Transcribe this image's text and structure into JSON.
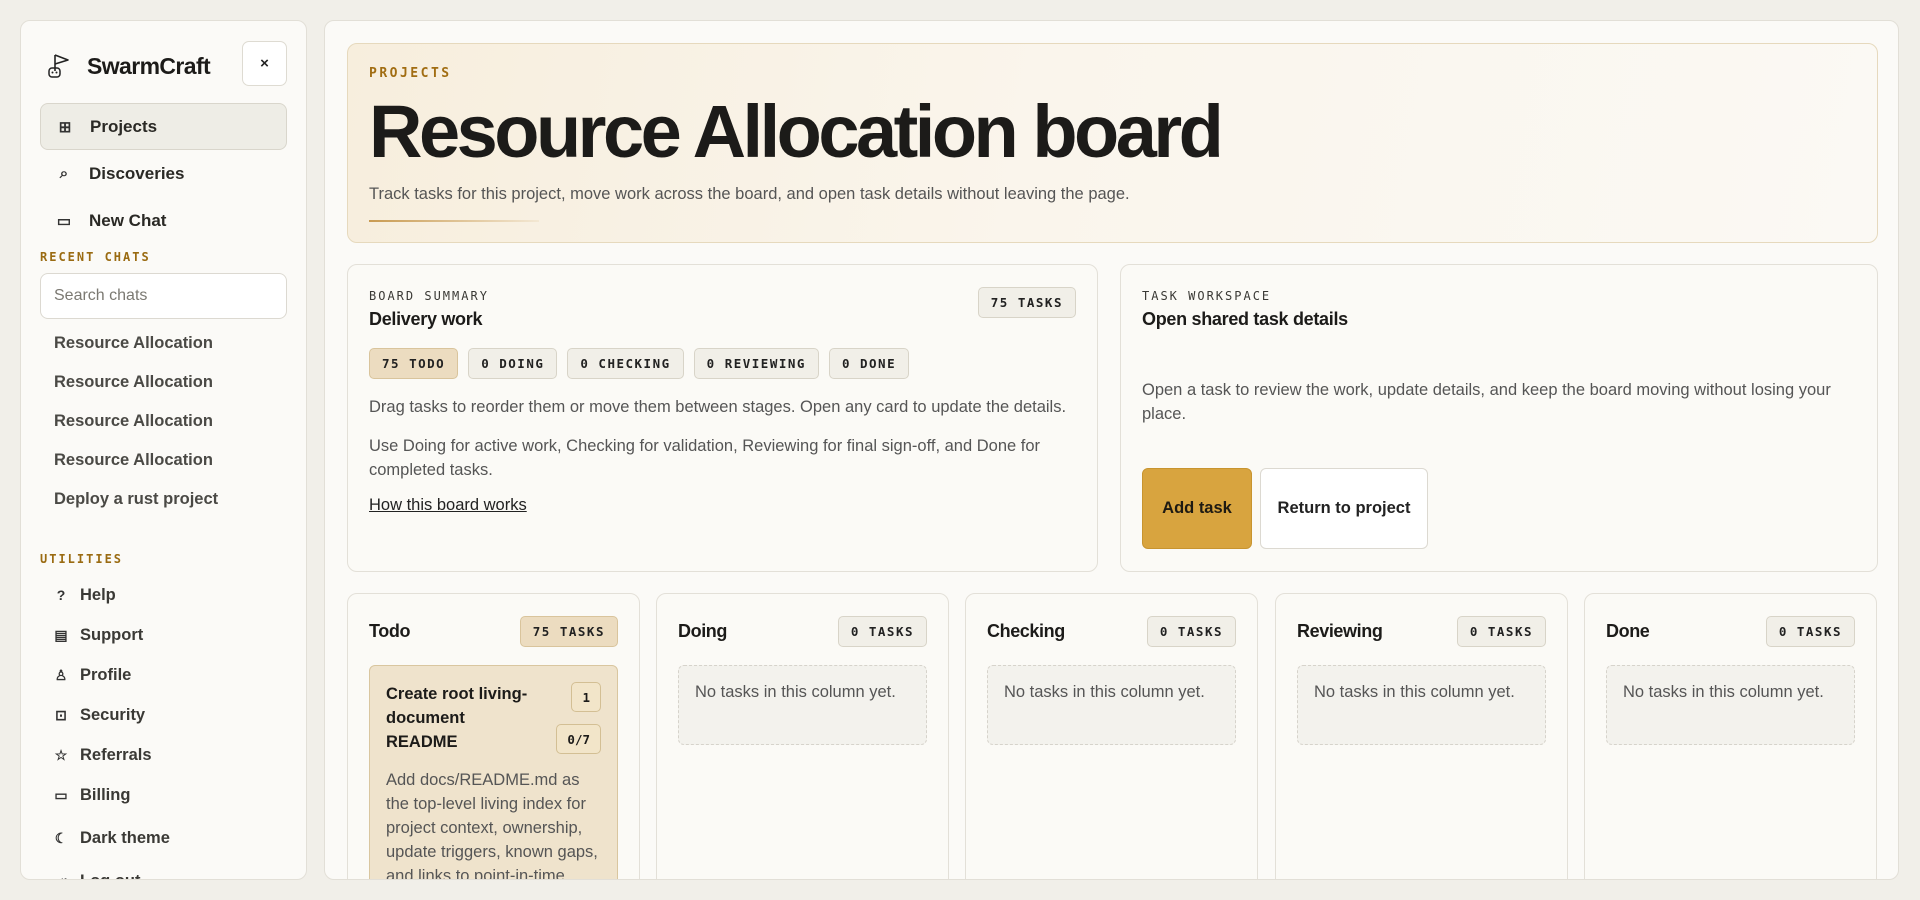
{
  "sidebar": {
    "brand": "SwarmCraft",
    "close_label": "×",
    "nav": [
      {
        "label": "Projects",
        "icon": "board-icon",
        "glyph": "⊞"
      },
      {
        "label": "Discoveries",
        "icon": "search-zoom-icon",
        "glyph": "⌕"
      },
      {
        "label": "New Chat",
        "icon": "chat-icon",
        "glyph": "▭"
      }
    ],
    "recent_label": "RECENT CHATS",
    "search_placeholder": "Search chats",
    "chats": [
      "Resource Allocation",
      "Resource Allocation",
      "Resource Allocation",
      "Resource Allocation",
      "Deploy a rust project"
    ],
    "utilities_label": "UTILITIES",
    "utilities": [
      {
        "label": "Help",
        "icon": "help-icon",
        "glyph": "?"
      },
      {
        "label": "Support",
        "icon": "support-icon",
        "glyph": "▤"
      },
      {
        "label": "Profile",
        "icon": "user-icon",
        "glyph": "♙"
      },
      {
        "label": "Security",
        "icon": "lock-icon",
        "glyph": "⊡"
      },
      {
        "label": "Referrals",
        "icon": "star-icon",
        "glyph": "☆"
      },
      {
        "label": "Billing",
        "icon": "card-icon",
        "glyph": "▭"
      },
      {
        "label": "Dark theme",
        "icon": "moon-icon",
        "glyph": "☾"
      },
      {
        "label": "Log out",
        "icon": "logout-icon",
        "glyph": "⇥"
      }
    ]
  },
  "hero": {
    "eyebrow": "PROJECTS",
    "title": "Resource Allocation board",
    "description": "Track tasks for this project, move work across the board, and open task details without leaving the page."
  },
  "summary": {
    "eyebrow": "BOARD SUMMARY",
    "title": "Delivery work",
    "total": "75 TASKS",
    "stages": [
      "75 TODO",
      "0 DOING",
      "0 CHECKING",
      "0 REVIEWING",
      "0 DONE"
    ],
    "para1": "Drag tasks to reorder them or move them between stages. Open any card to update the details.",
    "para2": "Use Doing for active work, Checking for validation, Reviewing for final sign-off, and Done for completed tasks.",
    "link": "How this board works"
  },
  "workspace": {
    "eyebrow": "TASK WORKSPACE",
    "title": "Open shared task details",
    "description": "Open a task to review the work, update details, and keep the board moving without losing your place.",
    "add_task": "Add task",
    "return": "Return to project"
  },
  "columns": [
    {
      "title": "Todo",
      "count": "75 TASKS"
    },
    {
      "title": "Doing",
      "count": "0 TASKS",
      "empty": "No tasks in this column yet."
    },
    {
      "title": "Checking",
      "count": "0 TASKS",
      "empty": "No tasks in this column yet."
    },
    {
      "title": "Reviewing",
      "count": "0 TASKS",
      "empty": "No tasks in this column yet."
    },
    {
      "title": "Done",
      "count": "0 TASKS",
      "empty": "No tasks in this column yet."
    }
  ],
  "task": {
    "title": "Create root living-document README",
    "number": "1",
    "progress": "0/7",
    "description": "Add docs/README.md as the top-level living index for project context, ownership, update triggers, known gaps, and links to point-in-time documents."
  },
  "colors": {
    "accent": "#d8a43f",
    "eyebrow": "#a16d12",
    "background": "#f1efe9"
  }
}
